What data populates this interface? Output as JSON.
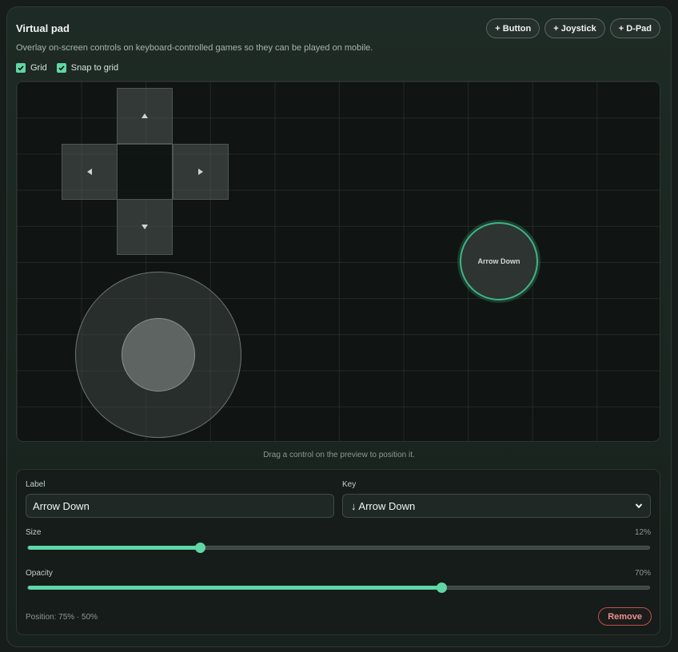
{
  "header": {
    "title": "Virtual pad",
    "subtitle": "Overlay on-screen controls on keyboard-controlled games so they can be played on mobile.",
    "add_buttons": [
      "+ Button",
      "+ Joystick",
      "+ D-Pad"
    ]
  },
  "toggles": [
    {
      "label": "Grid",
      "checked": true
    },
    {
      "label": "Snap to grid",
      "checked": true
    }
  ],
  "preview": {
    "button_control_label": "Arrow Down",
    "hint": "Drag a control on the preview to position it."
  },
  "editor": {
    "label_caption": "Label",
    "label_value": "Arrow Down",
    "key_caption": "Key",
    "key_value": "↓ Arrow Down",
    "size_caption": "Size",
    "size_value": "12%",
    "size_fraction": 0.277,
    "opacity_caption": "Opacity",
    "opacity_value": "70%",
    "opacity_fraction": 0.665,
    "position_text": "Position: 75% · 50%",
    "remove_label": "Remove"
  },
  "colors": {
    "accent": "#5fd6a6",
    "danger": "#ef8f8f"
  },
  "icons": [
    "check-icon",
    "arrow-up-icon",
    "arrow-down-icon",
    "arrow-left-icon",
    "arrow-right-icon",
    "chevron-down-icon"
  ]
}
